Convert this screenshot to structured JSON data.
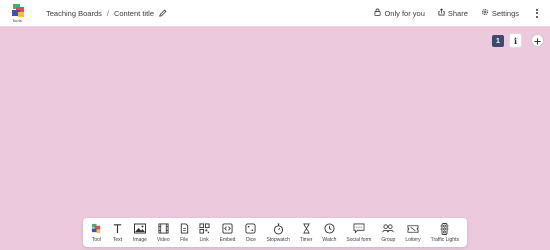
{
  "brand": {
    "logo_text": "Tools"
  },
  "breadcrumb": {
    "root": "Teaching Boards",
    "separator": "/",
    "current": "Content title"
  },
  "header": {
    "visibility_label": "Only for you",
    "share_label": "Share",
    "settings_label": "Settings"
  },
  "board": {
    "page_number": "1",
    "info_label": "i",
    "background_color": "#ecc9dd"
  },
  "toolbar": {
    "items": [
      {
        "label": "Tool",
        "icon": "tool-icon"
      },
      {
        "label": "Text",
        "icon": "text-icon"
      },
      {
        "label": "Image",
        "icon": "image-icon"
      },
      {
        "label": "Video",
        "icon": "video-icon"
      },
      {
        "label": "File",
        "icon": "file-icon"
      },
      {
        "label": "Link",
        "icon": "link-qr-icon"
      },
      {
        "label": "Embed",
        "icon": "embed-icon"
      },
      {
        "label": "Dice",
        "icon": "dice-icon"
      },
      {
        "label": "Stopwatch",
        "icon": "stopwatch-icon"
      },
      {
        "label": "Timer",
        "icon": "hourglass-icon"
      },
      {
        "label": "Watch",
        "icon": "clock-icon"
      },
      {
        "label": "Social form",
        "icon": "chat-icon"
      },
      {
        "label": "Group",
        "icon": "group-icon"
      },
      {
        "label": "Lottery",
        "icon": "ticket-icon"
      },
      {
        "label": "Traffic Lights",
        "icon": "traffic-lights-icon"
      }
    ]
  }
}
